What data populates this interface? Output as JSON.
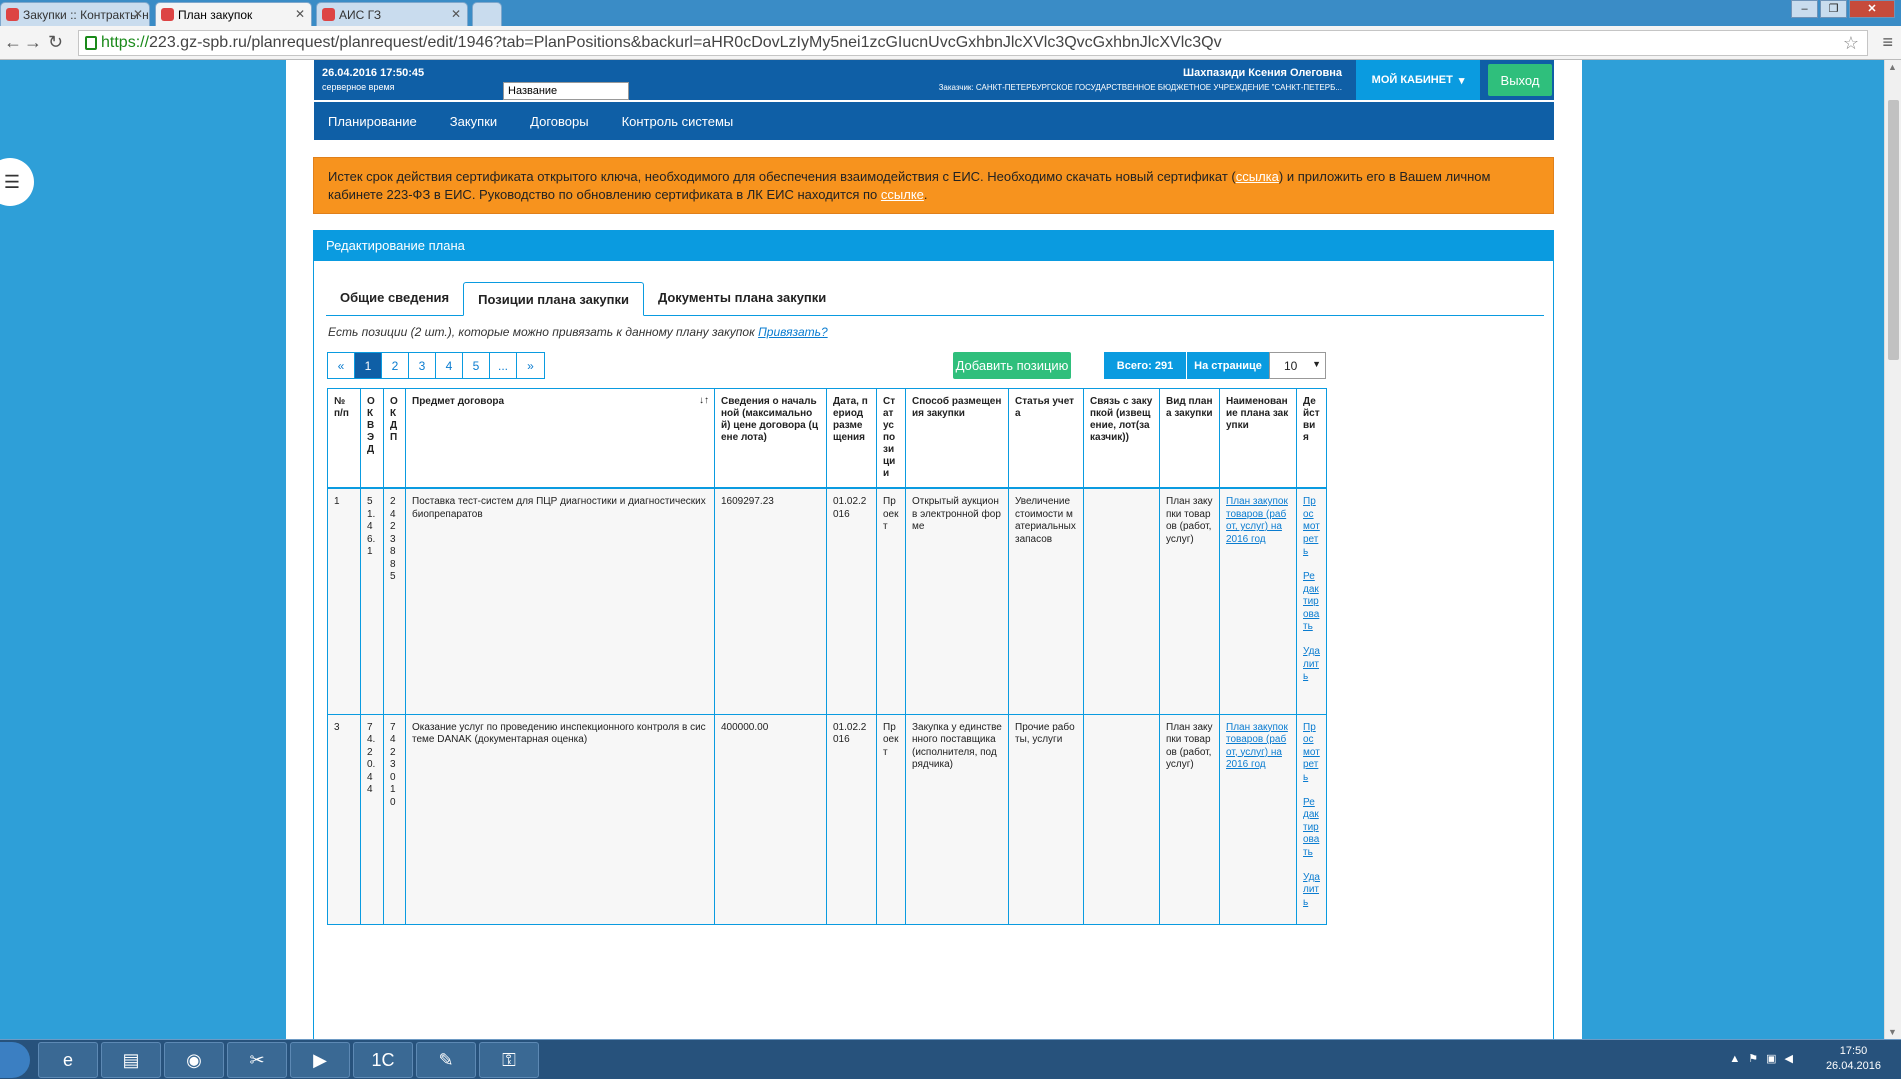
{
  "browser": {
    "tabs": [
      {
        "title": "Закупки :: Контракты на з",
        "active": false
      },
      {
        "title": "План закупок",
        "active": true
      },
      {
        "title": "АИС ГЗ",
        "active": false
      }
    ],
    "url_scheme": "https://",
    "url_rest": "223.gz-spb.ru/planrequest/planrequest/edit/1946?tab=PlanPositions&backurl=aHR0cDovLzIyMy5nei1zcGIucnUvcGxhbnJlcXVlc3QvcGxhbnJlcXVlc3Qv"
  },
  "header": {
    "datetime": "26.04.2016 17:50:45",
    "server_time_label": "серверное время",
    "name_popup": "Название",
    "user_name": "Шахпазиди Ксения Олеговна",
    "customer": "Заказчик: САНКТ-ПЕТЕРБУРГСКОЕ ГОСУДАРСТВЕННОЕ БЮДЖЕТНОЕ УЧРЕЖДЕНИЕ \"САНКТ-ПЕТЕРБ...",
    "cabinet_label": "МОЙ КАБИНЕТ",
    "logout_label": "Выход"
  },
  "nav": [
    "Планирование",
    "Закупки",
    "Договоры",
    "Контроль системы"
  ],
  "alert": {
    "part1": "Истек срок действия сертификата открытого ключа, необходимого для обеспечения взаимодействия с ЕИС. Необходимо скачать новый сертификат (",
    "link1": "ссылка",
    "part2": ") и приложить его в Вашем личном кабинете 223-ФЗ в ЕИС. Руководство по обновлению сертификата в ЛК ЕИС находится по ",
    "link2": "ссылке",
    "part3": "."
  },
  "panel": {
    "title": "Редактирование плана",
    "tabs": [
      "Общие сведения",
      "Позиции плана закупки",
      "Документы плана закупки"
    ],
    "hint_text": "Есть позиции (2 шт.), которые можно привязать к данному плану закупок ",
    "hint_link": "Привязать?",
    "pager": [
      "«",
      "1",
      "2",
      "3",
      "4",
      "5",
      "...",
      "»"
    ],
    "add_button": "Добавить позицию",
    "total_label": "Всего: 291",
    "per_page_label": "На странице",
    "per_page_value": "10"
  },
  "table": {
    "headers": [
      "№ п/п",
      "ОКВЭД",
      "ОКДП",
      "Предмет договора",
      "Сведения о начальной (максимальной) цене договора (цене лота)",
      "Дата, период размещения",
      "Статус позиции",
      "Способ размещения закупки",
      "Статья учета",
      "Связь с закупкой (извещение, лот(заказчик))",
      "Вид плана закупки",
      "Наименование плана закупки",
      "Действия"
    ],
    "rows": [
      {
        "num": "1",
        "okved": "51.46.1",
        "okdp": "2423885",
        "subject": "Поставка тест-систем для ПЦР диагностики и диагностических биопрепаратов",
        "price": "1609297.23",
        "date": "01.02.2016",
        "status": "Проект",
        "method": "Открытый аукцион в электронной форме",
        "article": "Увеличение стоимости материальных запасов",
        "link": "",
        "plan_type": "План закупки товаров (работ, услуг)",
        "plan_name": "План закупок товаров (работ, услуг) на 2016 год",
        "actions": [
          "Просмотреть",
          "Редактировать",
          "Удалить"
        ]
      },
      {
        "num": "3",
        "okved": "74.20.44",
        "okdp": "7423010",
        "subject": "Оказание услуг по проведению инспекционного контроля в системе DANAK (документарная оценка)",
        "price": "400000.00",
        "date": "01.02.2016",
        "status": "Проект",
        "method": "Закупка у единственного поставщика (исполнителя, подрядчика)",
        "article": "Прочие работы, услуги",
        "link": "",
        "plan_type": "План закупки товаров (работ, услуг)",
        "plan_name": "План закупок товаров (работ, услуг) на 2016 год",
        "actions": [
          "Просмотреть",
          "Редактировать",
          "Удалить"
        ]
      }
    ]
  },
  "taskbar": {
    "time": "17:50",
    "date": "26.04.2016"
  }
}
